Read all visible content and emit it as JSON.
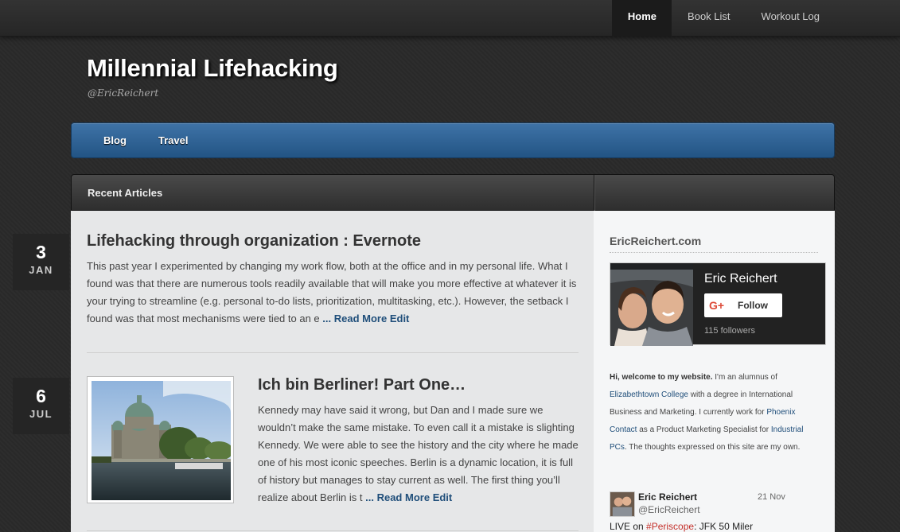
{
  "top_nav": {
    "items": [
      {
        "label": "Home",
        "active": true
      },
      {
        "label": "Book List",
        "active": false
      },
      {
        "label": "Workout Log",
        "active": false
      }
    ]
  },
  "header": {
    "title": "Millennial Lifehacking",
    "subtitle": "@EricReichert"
  },
  "main_nav": {
    "items": [
      {
        "label": "Blog"
      },
      {
        "label": "Travel"
      }
    ]
  },
  "content": {
    "section_title": "Recent Articles"
  },
  "articles": [
    {
      "day": "3",
      "month": "JAN",
      "title": "Lifehacking through organization : Evernote",
      "excerpt": "This past year I experimented by changing my work flow, both at the office and in my personal life. What I found was that there are numerous tools readily available that will make you more effective at whatever it is your trying to streamline (e.g. personal to-do lists, prioritization, multitasking, etc.). However, the setback I found was that most mechanisms were tied to an e",
      "read_more": "... Read More",
      "edit": "Edit"
    },
    {
      "day": "6",
      "month": "JUL",
      "title": "Ich bin Berliner! Part One…",
      "excerpt": "Kennedy may have said it wrong, but Dan and I made sure we wouldn’t make the same mistake. To even call it a mistake is slighting Kennedy. We were able to see the history and the city where he made one of his most iconic speeches. Berlin is a dynamic location, it is full of history but manages to stay current as well. The first thing you’ll realize about Berlin is t",
      "read_more": "... Read More",
      "edit": "Edit",
      "thumbnail_icon": "berlin-cathedral-photo"
    }
  ],
  "sidebar": {
    "heading": "EricReichert.com",
    "gplus": {
      "name": "Eric Reichert",
      "follow_label": "Follow",
      "g_icon": "G+",
      "followers": "115 followers"
    },
    "about": {
      "intro_bold": "Hi, welcome to my website.",
      "p1": " I'm an alumnus of ",
      "link1": "Elizabethtown College",
      "p2": " with a degree in International Business and Marketing. I currently work for ",
      "link2": "Phoenix Contact",
      "p3": " as a Product Marketing Specialist for ",
      "link3": "Industrial PCs",
      "p4": ". The thoughts expressed on this site are my own."
    },
    "tweet": {
      "name": "Eric Reichert",
      "handle": "@EricReichert",
      "date": "21 Nov",
      "text_prefix": "LIVE on ",
      "hashtag": "#Periscope",
      "text_suffix": ": JFK 50 Miler"
    }
  },
  "colors": {
    "blue_nav": "#2d6295",
    "link": "#1f4e7a",
    "date_badge": "#252525"
  }
}
